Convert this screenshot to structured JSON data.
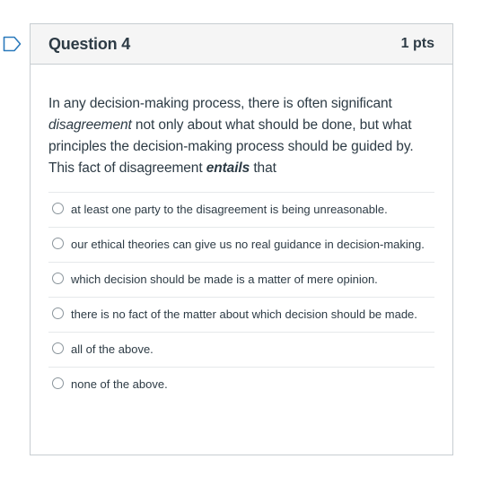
{
  "question": {
    "title": "Question 4",
    "points": "1 pts",
    "text_parts": {
      "p1": "In any decision-making process, there is often significant ",
      "em1": "disagreement",
      "p2": " not only about what should be done, but what principles the decision-making process should be guided by. This fact of disagreement ",
      "em2": "entails",
      "p3": " that"
    },
    "answers": [
      {
        "label": "at least one party to the disagreement is being unreasonable."
      },
      {
        "label": "our ethical theories can give us no real guidance in decision-making."
      },
      {
        "label": "which decision should be made is a matter of mere opinion."
      },
      {
        "label": "there is no fact of the matter about which decision should be made."
      },
      {
        "label": "all of the above."
      },
      {
        "label": "none of the above."
      }
    ]
  },
  "colors": {
    "flag": "#2b7abc",
    "text": "#2d3b45",
    "header_bg": "#f5f5f5",
    "border": "#c7cdd1"
  },
  "icons": {
    "flag": "flag-outline-icon",
    "radio": "radio-unselected"
  }
}
